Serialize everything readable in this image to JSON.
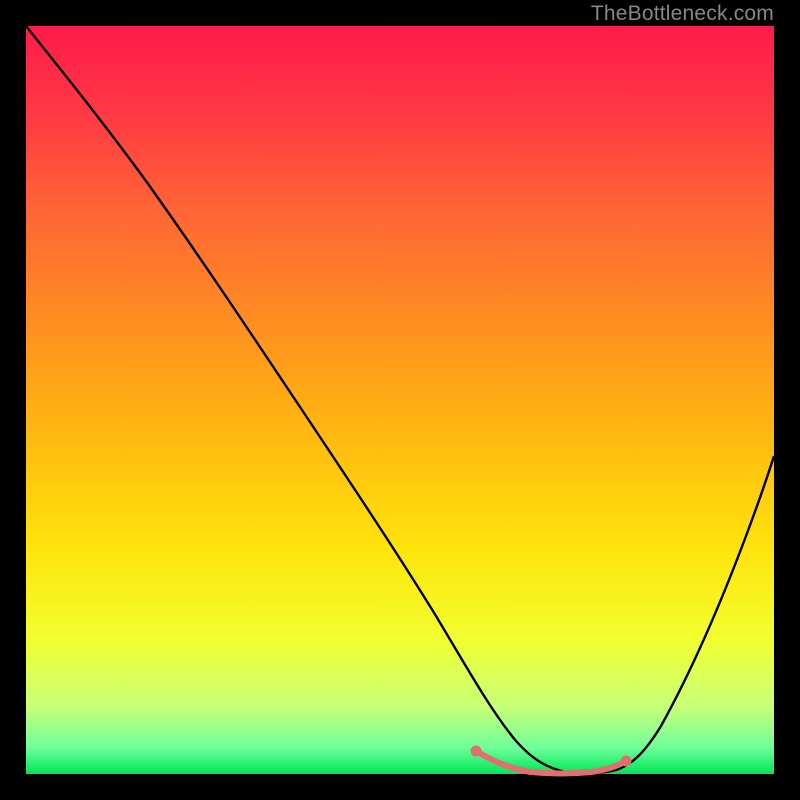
{
  "watermark": "TheBottleneck.com",
  "chart_data": {
    "type": "line",
    "title": "",
    "xlabel": "",
    "ylabel": "",
    "xlim": [
      0,
      100
    ],
    "ylim": [
      0,
      100
    ],
    "grid": false,
    "legend": false,
    "background_gradient": {
      "stops": [
        {
          "offset": 0.0,
          "color": "#ff1b4a"
        },
        {
          "offset": 0.12,
          "color": "#ff3a44"
        },
        {
          "offset": 0.25,
          "color": "#ff6635"
        },
        {
          "offset": 0.4,
          "color": "#ff9020"
        },
        {
          "offset": 0.55,
          "color": "#ffba10"
        },
        {
          "offset": 0.7,
          "color": "#ffe40c"
        },
        {
          "offset": 0.82,
          "color": "#f2ff30"
        },
        {
          "offset": 0.91,
          "color": "#c8ff78"
        },
        {
          "offset": 0.965,
          "color": "#6eff9a"
        },
        {
          "offset": 1.0,
          "color": "#00e557"
        }
      ]
    },
    "series": [
      {
        "name": "bottleneck-curve",
        "color": "#000000",
        "type": "line",
        "x": [
          0,
          5,
          10,
          15,
          20,
          25,
          30,
          35,
          40,
          45,
          50,
          55,
          58,
          60,
          63,
          66,
          70,
          74,
          78,
          80,
          84,
          88,
          92,
          96,
          100
        ],
        "y": [
          100,
          94,
          88,
          82,
          75,
          68,
          61,
          54,
          46,
          38,
          30,
          22,
          17,
          12,
          7,
          3,
          1,
          0,
          0,
          1,
          4,
          12,
          22,
          33,
          46
        ]
      },
      {
        "name": "highlighted-range",
        "color": "#e26f6f",
        "type": "line",
        "x": [
          60,
          63,
          66,
          70,
          74,
          78,
          80
        ],
        "y": [
          3.2,
          1.8,
          0.9,
          0.4,
          0.3,
          0.6,
          1.4
        ]
      }
    ],
    "markers": [
      {
        "x": 60,
        "y": 3.2,
        "color": "#e26f6f"
      },
      {
        "x": 80,
        "y": 1.4,
        "color": "#e26f6f"
      }
    ]
  }
}
